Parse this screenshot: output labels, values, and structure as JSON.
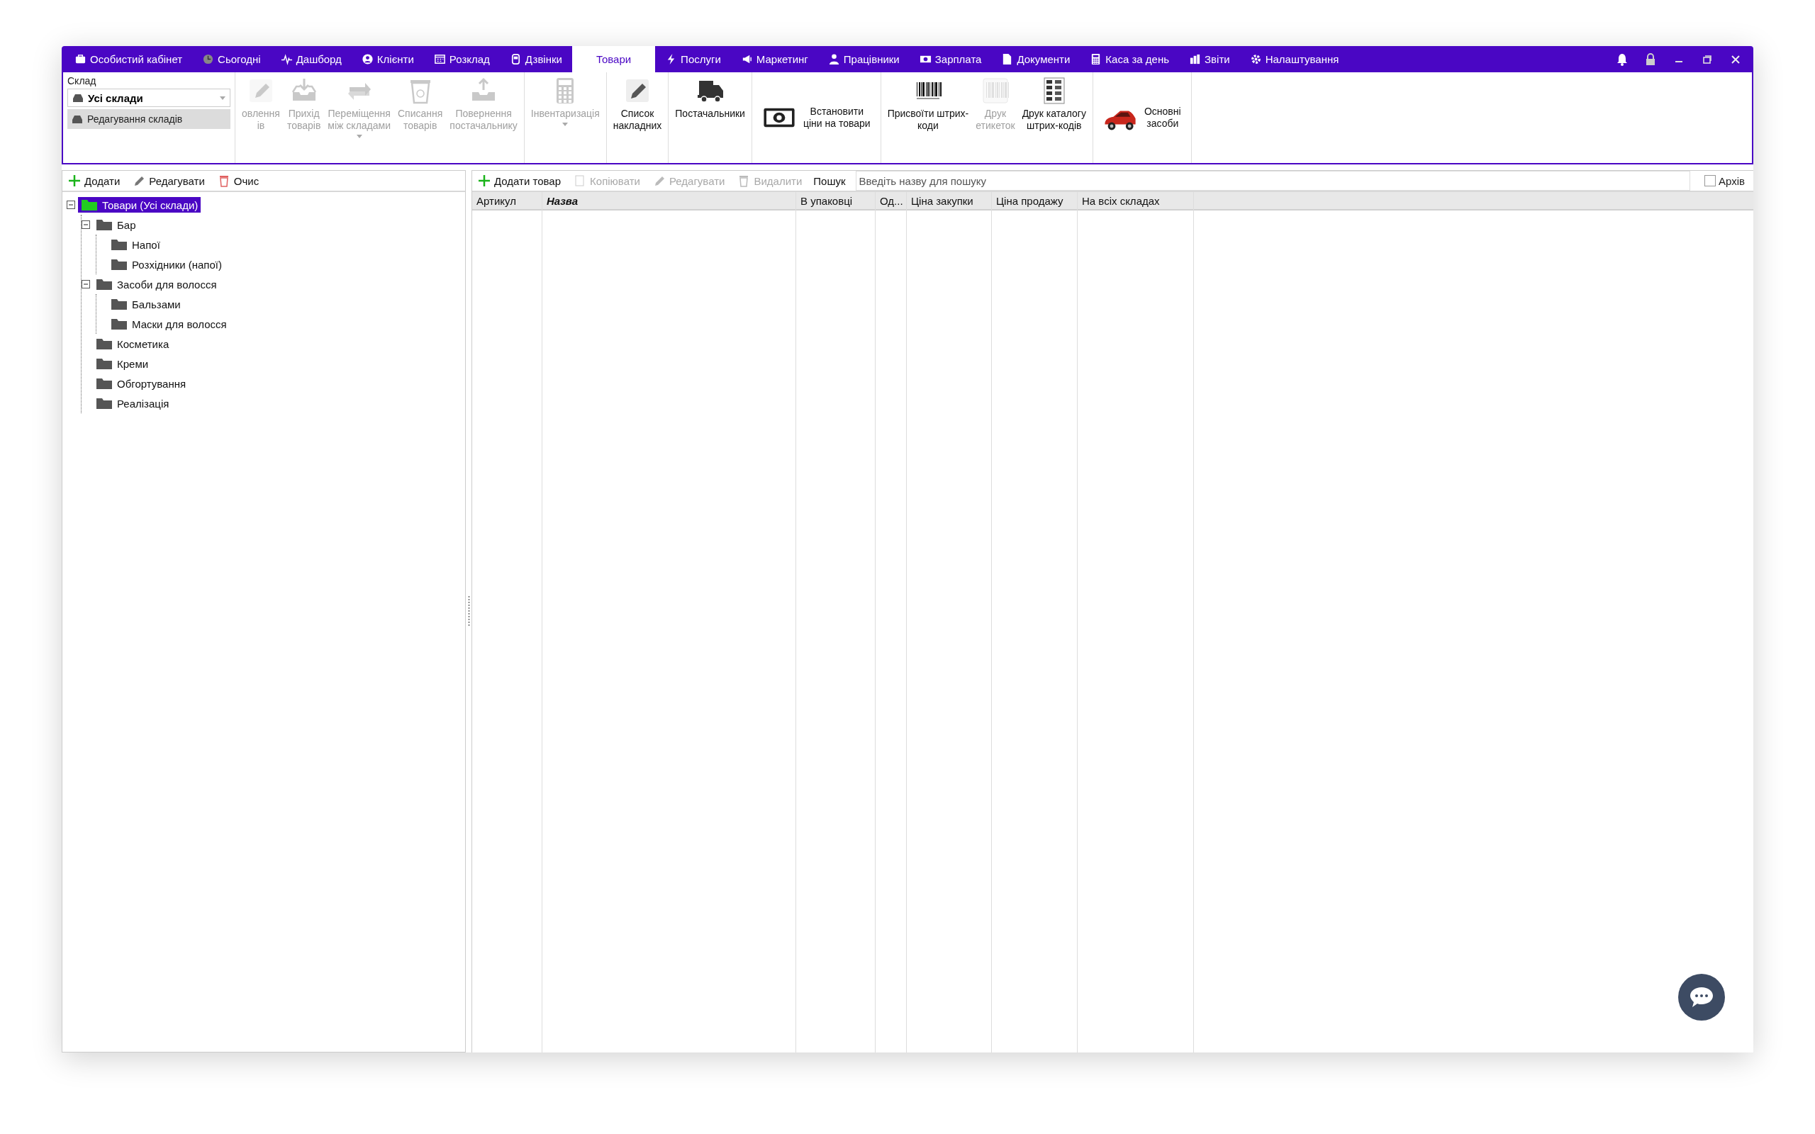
{
  "menu": [
    {
      "label": "Особистий кабінет",
      "selected": false
    },
    {
      "label": "Сьогодні",
      "selected": false
    },
    {
      "label": "Дашборд",
      "selected": false
    },
    {
      "label": "Клієнти",
      "selected": false
    },
    {
      "label": "Розклад",
      "selected": false
    },
    {
      "label": "Дзвінки",
      "selected": false
    },
    {
      "label": "Товари",
      "selected": true
    },
    {
      "label": "Послуги",
      "selected": false
    },
    {
      "label": "Маркетинг",
      "selected": false
    },
    {
      "label": "Працівники",
      "selected": false
    },
    {
      "label": "Зарплата",
      "selected": false
    },
    {
      "label": "Документи",
      "selected": false
    },
    {
      "label": "Каса за день",
      "selected": false
    },
    {
      "label": "Звіти",
      "selected": false
    },
    {
      "label": "Налаштування",
      "selected": false
    }
  ],
  "warehouse": {
    "label": "Склад",
    "value": "Усі склади",
    "edit_button": "Редагування складів"
  },
  "toolbar_groups": [
    [
      {
        "label": "овлення\nів",
        "disabled": true,
        "dropdown": false,
        "kind": "stacked"
      },
      {
        "label": "Прихід\nтоварів",
        "disabled": true,
        "dropdown": false,
        "kind": "stacked"
      },
      {
        "label": "Переміщення\nміж складами",
        "disabled": true,
        "dropdown": true,
        "kind": "stacked"
      },
      {
        "label": "Списання\nтоварів",
        "disabled": true,
        "dropdown": false,
        "kind": "stacked"
      },
      {
        "label": "Повернення\nпостачальнику",
        "disabled": true,
        "dropdown": false,
        "kind": "stacked"
      }
    ],
    [
      {
        "label": "Інвентаризація",
        "disabled": true,
        "dropdown": true,
        "kind": "stacked"
      }
    ],
    [
      {
        "label": "Список\nнакладних",
        "disabled": false,
        "dropdown": false,
        "kind": "stacked"
      }
    ],
    [
      {
        "label": "Постачальники",
        "disabled": false,
        "dropdown": false,
        "kind": "stacked"
      }
    ],
    [
      {
        "label": "Встановити\nціни на товари",
        "disabled": false,
        "dropdown": false,
        "kind": "inline"
      }
    ],
    [
      {
        "label": "Присвоїти штрих-\nкоди",
        "disabled": false,
        "dropdown": false,
        "kind": "stacked"
      },
      {
        "label": "Друк\nетикеток",
        "disabled": true,
        "dropdown": false,
        "kind": "stacked"
      },
      {
        "label": "Друк каталогу\nштрих-кодів",
        "disabled": false,
        "dropdown": false,
        "kind": "stacked"
      }
    ],
    [
      {
        "label": "Основні\nзасоби",
        "disabled": false,
        "dropdown": false,
        "kind": "inline"
      }
    ]
  ],
  "tree_toolbar": [
    {
      "label": "Додати"
    },
    {
      "label": "Редагувати"
    },
    {
      "label": "Очис"
    }
  ],
  "tree": [
    {
      "label": "Товари (Усі склади)",
      "selected": true,
      "expanded": true,
      "children": [
        {
          "label": "Бар",
          "selected": false,
          "expanded": true,
          "children": [
            {
              "label": "Напої",
              "selected": false
            },
            {
              "label": "Розхідники (напої)",
              "selected": false
            }
          ]
        },
        {
          "label": "Засоби для волосся",
          "selected": false,
          "expanded": true,
          "children": [
            {
              "label": "Бальзами",
              "selected": false
            },
            {
              "label": "Маски для волосся",
              "selected": false
            }
          ]
        },
        {
          "label": "Косметика",
          "selected": false
        },
        {
          "label": "Креми",
          "selected": false
        },
        {
          "label": "Обгортування",
          "selected": false
        },
        {
          "label": "Реалізація",
          "selected": false
        }
      ]
    }
  ],
  "products": {
    "buttons": [
      {
        "label": "Додати товар",
        "disabled": false
      },
      {
        "label": "Копіювати",
        "disabled": true
      },
      {
        "label": "Редагувати",
        "disabled": true
      },
      {
        "label": "Видалити",
        "disabled": true
      }
    ],
    "search": {
      "label": "Пошук",
      "placeholder": "Введіть назву для пошуку"
    },
    "archive": {
      "label": "Архів",
      "checked": false
    }
  },
  "table": {
    "columns": [
      {
        "label": "Артикул",
        "emphasized": false
      },
      {
        "label": "Назва",
        "emphasized": true
      },
      {
        "label": "В упаковці",
        "emphasized": false
      },
      {
        "label": "Од...",
        "emphasized": false
      },
      {
        "label": "Ціна закупки",
        "emphasized": false
      },
      {
        "label": "Ціна продажу",
        "emphasized": false
      },
      {
        "label": "На всіх складах",
        "emphasized": false
      }
    ]
  }
}
